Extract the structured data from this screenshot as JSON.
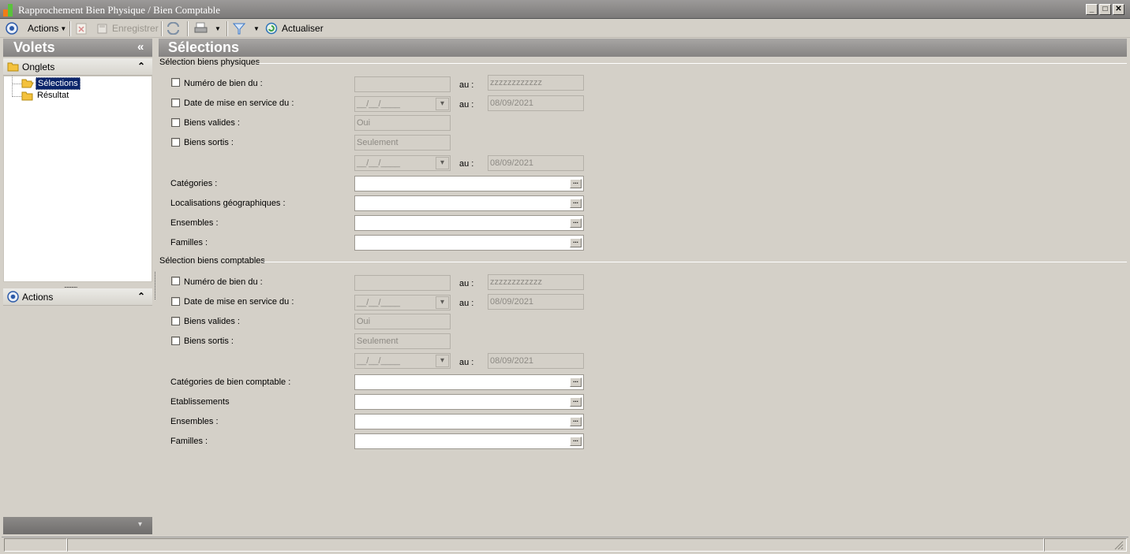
{
  "window": {
    "title": "Rapprochement Bien Physique / Bien Comptable",
    "controls": {
      "minimize": "_",
      "maximize": "□",
      "close": "✕"
    }
  },
  "toolbar": {
    "actions_label": "Actions",
    "save_label": "Enregistrer",
    "refresh_label": "Actualiser"
  },
  "left_panel": {
    "title": "Volets",
    "collapse_glyph": "«",
    "onglets_label": "Onglets",
    "tree": [
      "Sélections",
      "Résultat"
    ],
    "actions_label": "Actions",
    "group_glyph": "⌃",
    "splitter_dots": "...........",
    "bottom_glyph": "▾"
  },
  "main": {
    "title": "Sélections",
    "physical": {
      "heading": "Sélection biens physiques",
      "numero_label": "Numéro de bien du :",
      "numero_to": "zzzzzzzzzzzz",
      "date_label": "Date de mise en service du :",
      "date_placeholder": "__/__/____",
      "date_to": "08/09/2021",
      "valides_label": "Biens valides :",
      "valides_value": "Oui",
      "sortis_label": "Biens sortis :",
      "sortis_value": "Seulement",
      "sortis_date_to": "08/09/2021",
      "categories_label": "Catégories :",
      "localisations_label": "Localisations géographiques :",
      "ensembles_label": "Ensembles :",
      "familles_label": "Familles  :"
    },
    "accounting": {
      "heading": "Sélection biens comptables",
      "numero_label": "Numéro de bien du :",
      "numero_to": "zzzzzzzzzzzz",
      "date_label": "Date de mise en service du :",
      "date_placeholder": "__/__/____",
      "date_to": "08/09/2021",
      "valides_label": "Biens valides :",
      "valides_value": "Oui",
      "sortis_label": "Biens sortis :",
      "sortis_value": "Seulement",
      "sortis_date_to": "08/09/2021",
      "categories_label": "Catégories de bien comptable  :",
      "etablissements_label": "Etablissements",
      "ensembles_label": "Ensembles :",
      "familles_label": "Familles :"
    },
    "to_label": "au :",
    "ellipsis": "...",
    "dropdown_glyph": "▾"
  }
}
